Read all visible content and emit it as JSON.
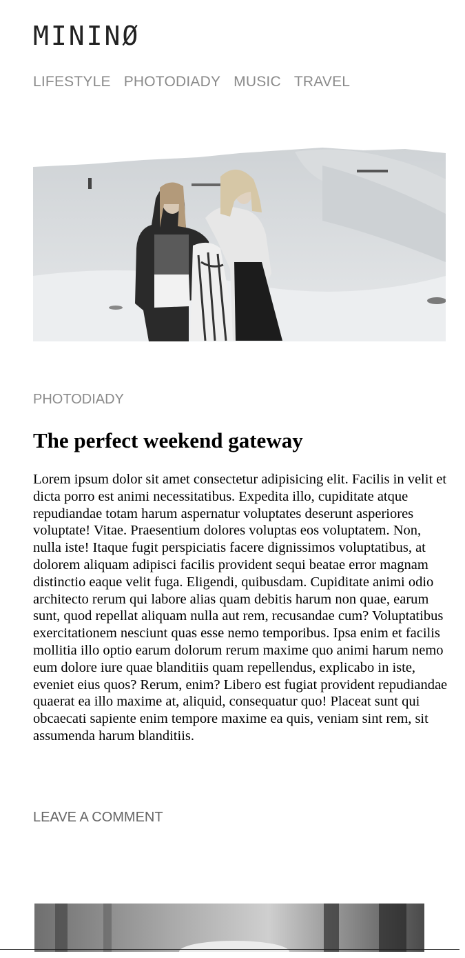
{
  "site": {
    "title": "MININØ"
  },
  "nav": {
    "items": [
      {
        "label": "LIFESTYLE"
      },
      {
        "label": "PHOTODIADY"
      },
      {
        "label": "MUSIC"
      },
      {
        "label": "TRAVEL"
      }
    ]
  },
  "post": {
    "category": "PHOTODIADY",
    "title": "The perfect weekend gateway",
    "body": "Lorem ipsum dolor sit amet consectetur adipisicing elit. Facilis in velit et dicta porro est animi necessitatibus. Expedita illo, cupiditate atque repudiandae totam harum aspernatur voluptates deserunt asperiores voluptate! Vitae. Praesentium dolores voluptas eos voluptatem. Non, nulla iste! Itaque fugit perspiciatis facere dignissimos voluptatibus, at dolorem aliquam adipisci facilis provident sequi beatae error magnam distinctio eaque velit fuga. Eligendi, quibusdam. Cupiditate animi odio architecto rerum qui labore alias quam debitis harum non quae, earum sunt, quod repellat aliquam nulla aut rem, recusandae cum? Voluptatibus exercitationem nesciunt quas esse nemo temporibus. Ipsa enim et facilis mollitia illo optio earum dolorum rerum maxime quo animi harum nemo eum dolore iure quae blanditiis quam repellendus, explicabo in iste, eveniet eius quos? Rerum, enim? Libero est fugiat provident repudiandae quaerat ea illo maxime at, aliquid, consequatur quo! Placeat sunt qui obcaecati sapiente enim tempore maxime ea quis, veniam sint rem, sit assumenda harum blanditiis.",
    "comment_link": "LEAVE A COMMENT"
  },
  "colors": {
    "nav_text": "#8a8a8a",
    "title_text": "#222222",
    "body_text": "#000000"
  }
}
